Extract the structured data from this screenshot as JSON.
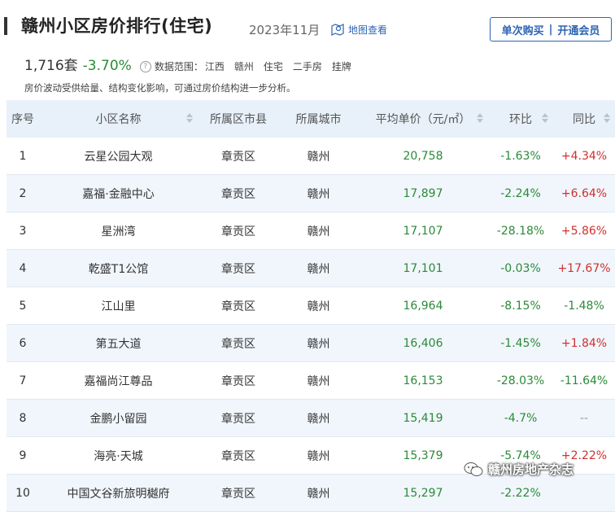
{
  "header": {
    "title": "赣州小区房价排行(住宅)",
    "date": "2023年11月",
    "map_link": "地图查看",
    "buy_once": "单次购买",
    "divider": "|",
    "membership": "开通会员"
  },
  "stats": {
    "count": "1,716套",
    "change": "-3.70%",
    "help_icon": "?",
    "scope_label": "数据范围：",
    "scope": [
      "江西",
      "赣州",
      "住宅",
      "二手房",
      "挂牌"
    ]
  },
  "note": "房价波动受供给量、结构变化影响，可通过房价结构进一步分析。",
  "table": {
    "columns": [
      "序号",
      "小区名称",
      "所属区市县",
      "所属城市",
      "平均单价（元/㎡）",
      "环比",
      "同比"
    ],
    "rows": [
      {
        "rank": "1",
        "name": "云星公园大观",
        "district": "章贡区",
        "city": "赣州",
        "price": "20,758",
        "mom": "-1.63%",
        "yoy": "+4.34%"
      },
      {
        "rank": "2",
        "name": "嘉福·金融中心",
        "district": "章贡区",
        "city": "赣州",
        "price": "17,897",
        "mom": "-2.24%",
        "yoy": "+6.64%"
      },
      {
        "rank": "3",
        "name": "星洲湾",
        "district": "章贡区",
        "city": "赣州",
        "price": "17,107",
        "mom": "-28.18%",
        "yoy": "+5.86%"
      },
      {
        "rank": "4",
        "name": "乾盛T1公馆",
        "district": "章贡区",
        "city": "赣州",
        "price": "17,101",
        "mom": "-0.03%",
        "yoy": "+17.67%"
      },
      {
        "rank": "5",
        "name": "江山里",
        "district": "章贡区",
        "city": "赣州",
        "price": "16,964",
        "mom": "-8.15%",
        "yoy": "-1.48%"
      },
      {
        "rank": "6",
        "name": "第五大道",
        "district": "章贡区",
        "city": "赣州",
        "price": "16,406",
        "mom": "-1.45%",
        "yoy": "+1.84%"
      },
      {
        "rank": "7",
        "name": "嘉福尚江尊品",
        "district": "章贡区",
        "city": "赣州",
        "price": "16,153",
        "mom": "-28.03%",
        "yoy": "-11.64%"
      },
      {
        "rank": "8",
        "name": "金鹏小留园",
        "district": "章贡区",
        "city": "赣州",
        "price": "15,419",
        "mom": "-4.7%",
        "yoy": "--"
      },
      {
        "rank": "9",
        "name": "海亮·天城",
        "district": "章贡区",
        "city": "赣州",
        "price": "15,379",
        "mom": "-5.74%",
        "yoy": "+2.22%"
      },
      {
        "rank": "10",
        "name": "中国文谷新旅明樾府",
        "district": "章贡区",
        "city": "赣州",
        "price": "15,297",
        "mom": "-2.22%",
        "yoy": ""
      }
    ]
  },
  "watermark": "赣州房地产杂志",
  "colors": {
    "accent": "#2d64b3",
    "down": "#2a8a38",
    "up": "#d0302f",
    "header_bg": "#e8f1fa",
    "alt_row": "#f1f6fc"
  }
}
